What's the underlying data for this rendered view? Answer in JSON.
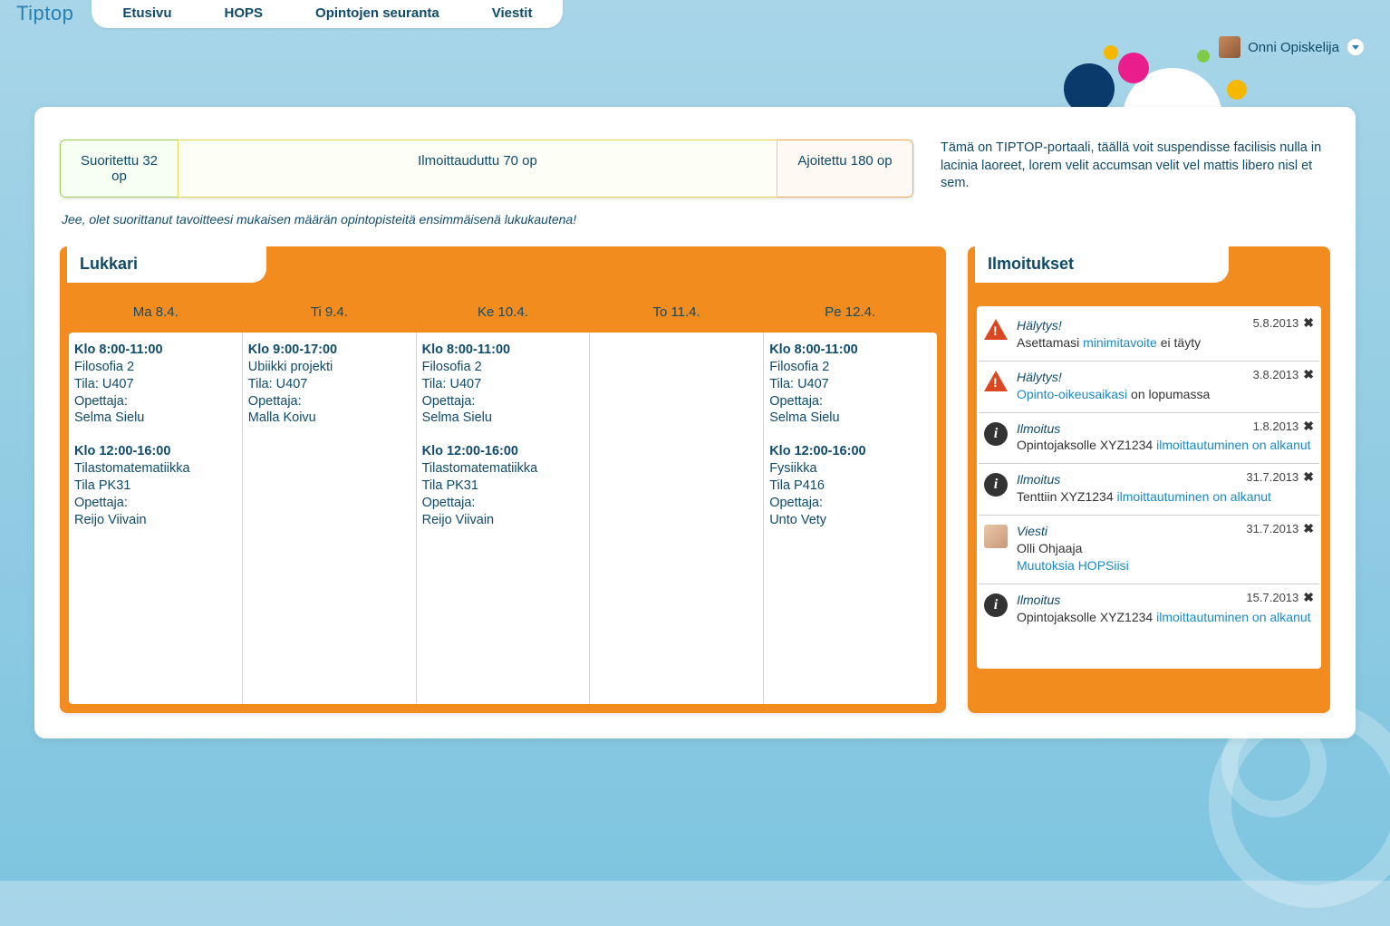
{
  "app": {
    "name": "Tiptop"
  },
  "nav": {
    "items": [
      "Etusivu",
      "HOPS",
      "Opintojen seuranta",
      "Viestit"
    ]
  },
  "user": {
    "name": "Onni Opiskelija"
  },
  "progress": {
    "completed": "Suoritettu 32 op",
    "enrolled": "Ilmoittauduttu 70 op",
    "scheduled": "Ajoitettu 180 op"
  },
  "intro": "Tämä on TIPTOP-portaali, täällä voit suspendisse facilisis nulla in lacinia laoreet, lorem velit accumsan velit vel mattis libero nisl et sem.",
  "success_msg": "Jee, olet suorittanut tavoitteesi mukaisen määrän opintopisteitä ensimmäisenä lukukautena!",
  "schedule": {
    "title": "Lukkari",
    "days": [
      {
        "label": "Ma 8.4.",
        "events": [
          {
            "time": "Klo 8:00-11:00",
            "course": "Filosofia 2",
            "room": "Tila: U407",
            "teacher_lbl": "Opettaja:",
            "teacher": "Selma Sielu"
          },
          {
            "time": "Klo 12:00-16:00",
            "course": "Tilastomatematiikka",
            "room": "Tila PK31",
            "teacher_lbl": "Opettaja:",
            "teacher": "Reijo Viivain"
          }
        ]
      },
      {
        "label": "Ti 9.4.",
        "events": [
          {
            "time": "Klo 9:00-17:00",
            "course": "Ubiikki projekti",
            "room": "Tila: U407",
            "teacher_lbl": "Opettaja:",
            "teacher": "Malla Koivu"
          }
        ]
      },
      {
        "label": "Ke 10.4.",
        "events": [
          {
            "time": "Klo 8:00-11:00",
            "course": "Filosofia 2",
            "room": "Tila: U407",
            "teacher_lbl": "Opettaja:",
            "teacher": "Selma Sielu"
          },
          {
            "time": "Klo 12:00-16:00",
            "course": "Tilastomatematiikka",
            "room": "Tila PK31",
            "teacher_lbl": "Opettaja:",
            "teacher": "Reijo Viivain"
          }
        ]
      },
      {
        "label": "To 11.4.",
        "events": []
      },
      {
        "label": "Pe 12.4.",
        "events": [
          {
            "time": "Klo 8:00-11:00",
            "course": "Filosofia 2",
            "room": "Tila: U407",
            "teacher_lbl": "Opettaja:",
            "teacher": "Selma Sielu"
          },
          {
            "time": "Klo 12:00-16:00",
            "course": "Fysiikka",
            "room": "Tila P416",
            "teacher_lbl": "Opettaja:",
            "teacher": "Unto Vety"
          }
        ]
      }
    ]
  },
  "notifications": {
    "title": "Ilmoitukset",
    "items": [
      {
        "icon": "alert",
        "title": "Hälytys!",
        "date": "5.8.2013",
        "pre": "Asettamasi ",
        "link": "minimitavoite",
        "post": " ei täyty"
      },
      {
        "icon": "alert",
        "title": "Hälytys!",
        "date": "3.8.2013",
        "pre": "",
        "link": "Opinto-oikeusaikasi",
        "post": " on lopumassa"
      },
      {
        "icon": "info",
        "title": "Ilmoitus",
        "date": "1.8.2013",
        "pre": "Opintojaksolle XYZ1234 ",
        "link": "ilmoittautuminen on alkanut",
        "post": ""
      },
      {
        "icon": "info",
        "title": "Ilmoitus",
        "date": "31.7.2013",
        "pre": "Tenttiin XYZ1234 ",
        "link": "ilmoittautuminen on alkanut",
        "post": ""
      },
      {
        "icon": "avatar",
        "title": "Viesti",
        "date": "31.7.2013",
        "pre": "Olli Ohjaaja",
        "link": "Muutoksia HOPSiisi",
        "post": "",
        "twoLine": true
      },
      {
        "icon": "info",
        "title": "Ilmoitus",
        "date": "15.7.2013",
        "pre": "Opintojaksolle XYZ1234 ",
        "link": "ilmoittautuminen on alkanut",
        "post": ""
      }
    ]
  }
}
